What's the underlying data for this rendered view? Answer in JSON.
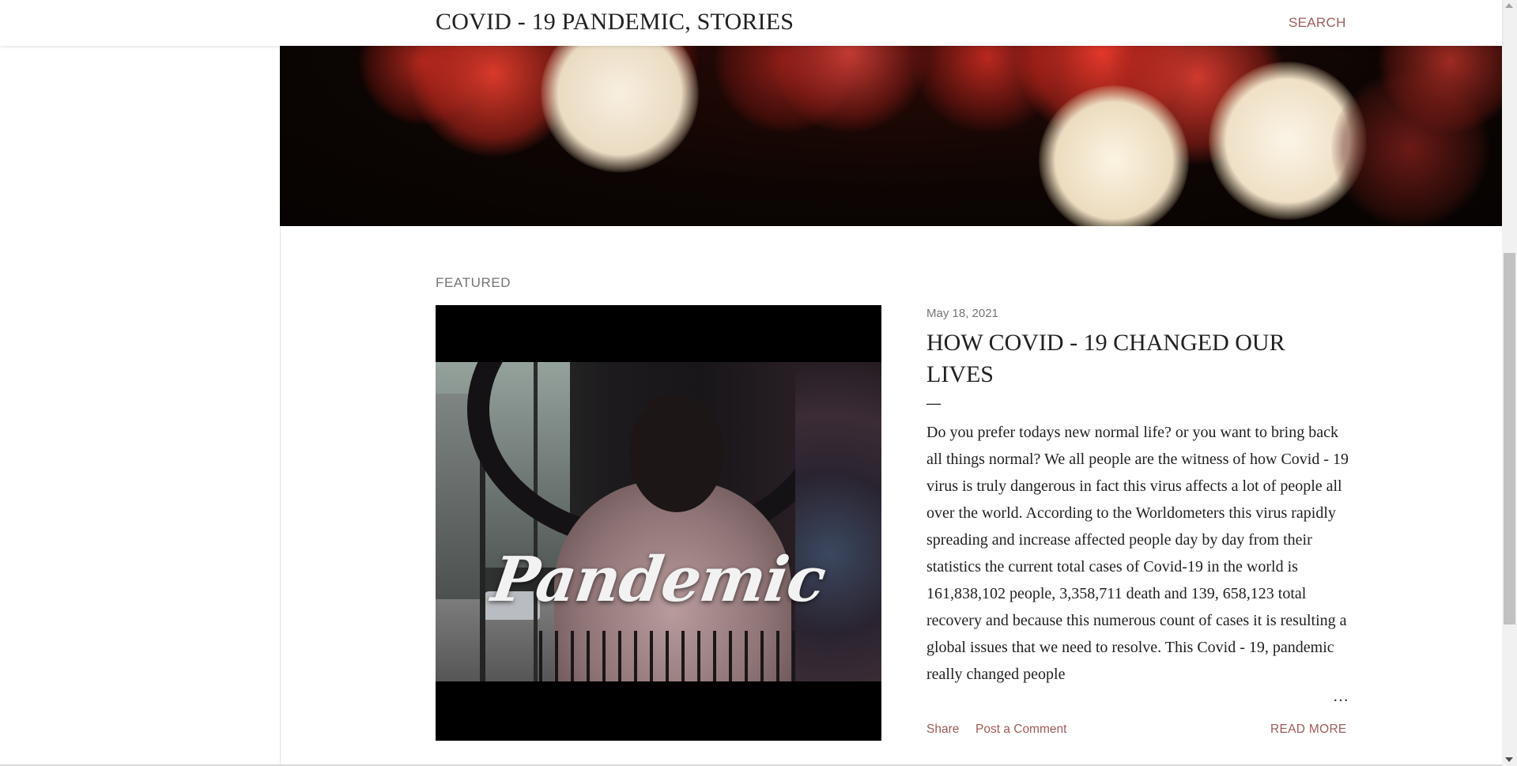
{
  "header": {
    "site_title": "COVID - 19 PANDEMIC, STORIES",
    "search_label": "SEARCH"
  },
  "featured": {
    "section_label": "FEATURED",
    "image_text": "Pandemic",
    "post": {
      "date": "May 18, 2021",
      "title": "HOW COVID - 19 CHANGED OUR LIVES",
      "separator": "—",
      "snippet": "Do you prefer todays new normal life? or you want to bring back all things normal?       We all people are the witness of how Covid - 19 virus is truly dangerous in fact this virus affects a lot of people all over the world. According to the Worldometers this virus rapidly spreading and increase affected people day by day from their statistics the current total cases of Covid-19 in the world is 161,838,102 people, 3,358,711 death and 139, 658,123 total recovery and because this numerous count of cases it is resulting a global issues that we need to resolve. This Covid - 19, pandemic really changed people",
      "ellipsis": "…",
      "share_label": "Share",
      "comment_label": "Post a Comment",
      "read_more_label": "READ MORE"
    }
  },
  "colors": {
    "accent_link": "#a05a5a",
    "text_primary": "#212121",
    "text_muted": "#757575"
  }
}
